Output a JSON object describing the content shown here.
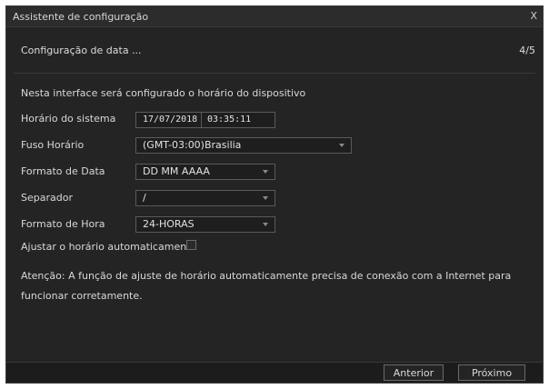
{
  "window": {
    "title": "Assistente de configuração",
    "close_label": "X"
  },
  "step": {
    "title": "Configuração de data ...",
    "counter": "4/5"
  },
  "description": "Nesta interface será configurado o horário do dispositivo",
  "fields": {
    "system_time": {
      "label": "Horário do sistema",
      "date": "17/07/2018",
      "time": "03:35:11"
    },
    "timezone": {
      "label": "Fuso Horário",
      "value": "(GMT-03:00)Brasilia"
    },
    "date_format": {
      "label": "Formato de Data",
      "value": "DD MM AAAA"
    },
    "separator": {
      "label": "Separador",
      "value": "/"
    },
    "time_format": {
      "label": "Formato de Hora",
      "value": "24-HORAS"
    },
    "auto_adjust": {
      "label": "Ajustar o horário automaticamente",
      "checked": false
    }
  },
  "note": "Atenção: A função de ajuste de horário automaticamente precisa de conexão com a Internet para funcionar corretamente.",
  "buttons": {
    "previous": "Anterior",
    "next": "Próximo"
  }
}
